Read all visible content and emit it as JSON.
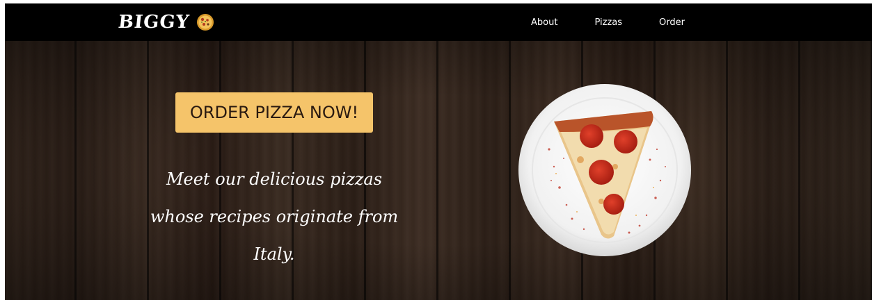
{
  "brand": {
    "logo_text": "BIGGY",
    "logo_icon": "pizza-icon"
  },
  "nav": {
    "links": [
      {
        "label": "About"
      },
      {
        "label": "Pizzas"
      },
      {
        "label": "Order"
      }
    ]
  },
  "hero": {
    "cta_label": "ORDER PIZZA NOW!",
    "tagline_line1": "Meet our delicious pizzas",
    "tagline_line2": "whose recipes originate from Italy.",
    "image": "pepperoni-pizza-slice-on-plate"
  },
  "colors": {
    "navbar": "#000000",
    "cta_background": "#f5c46a",
    "cta_text": "#2a1a10",
    "wood": "#2f2119"
  }
}
